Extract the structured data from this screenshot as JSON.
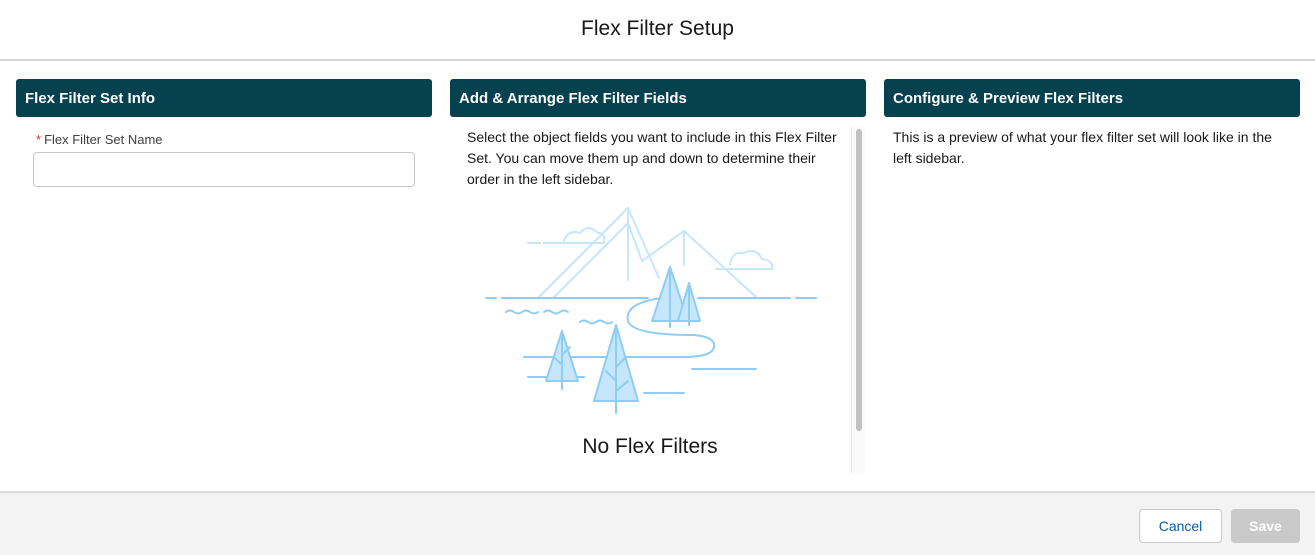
{
  "modal": {
    "title": "Flex Filter Setup"
  },
  "panels": {
    "info": {
      "header": "Flex Filter Set Info",
      "name_field": {
        "required_marker": "*",
        "label": "Flex Filter Set Name",
        "value": "",
        "placeholder": ""
      }
    },
    "fields": {
      "header": "Add & Arrange Flex Filter Fields",
      "description": "Select the object fields you want to include in this Flex Filter Set. You can move them up and down to determine their order in the left sidebar.",
      "empty_state_title": "No Flex Filters"
    },
    "preview": {
      "header": "Configure & Preview Flex Filters",
      "description": "This is a preview of what your flex filter set will look like in the left sidebar."
    }
  },
  "footer": {
    "cancel_label": "Cancel",
    "save_label": "Save"
  },
  "colors": {
    "panel_header_bg": "#05414f",
    "illustration_stroke": "#8ecdf4",
    "illustration_fill": "#c5e6fb",
    "link_blue": "#0b5cab"
  },
  "icons": {
    "empty_state": "mountains-trees-illustration"
  }
}
